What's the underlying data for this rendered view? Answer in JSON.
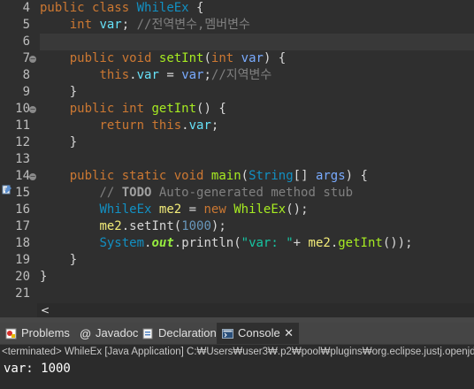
{
  "editor": {
    "line_numbers": [
      "4",
      "5",
      "6",
      "7",
      "8",
      "9",
      "10",
      "11",
      "12",
      "13",
      "14",
      "15",
      "16",
      "17",
      "18",
      "19",
      "20",
      "21"
    ],
    "lines": [
      [
        {
          "t": "public",
          "c": "kw"
        },
        {
          "t": " ",
          "c": "plain"
        },
        {
          "t": "class",
          "c": "kw"
        },
        {
          "t": " ",
          "c": "plain"
        },
        {
          "t": "WhileEx",
          "c": "cls"
        },
        {
          "t": " {",
          "c": "plain"
        }
      ],
      [
        {
          "t": "    ",
          "c": "plain"
        },
        {
          "t": "int",
          "c": "kw"
        },
        {
          "t": " ",
          "c": "plain"
        },
        {
          "t": "var",
          "c": "field"
        },
        {
          "t": "; ",
          "c": "plain"
        },
        {
          "t": "//전역변수,멤버변수",
          "c": "com"
        }
      ],
      [
        {
          "t": "",
          "c": "plain"
        }
      ],
      [
        {
          "t": "    ",
          "c": "plain"
        },
        {
          "t": "public",
          "c": "kw"
        },
        {
          "t": " ",
          "c": "plain"
        },
        {
          "t": "void",
          "c": "kw"
        },
        {
          "t": " ",
          "c": "plain"
        },
        {
          "t": "setInt",
          "c": "method"
        },
        {
          "t": "(",
          "c": "plain"
        },
        {
          "t": "int",
          "c": "kw"
        },
        {
          "t": " ",
          "c": "plain"
        },
        {
          "t": "var",
          "c": "param"
        },
        {
          "t": ") {",
          "c": "plain"
        }
      ],
      [
        {
          "t": "        ",
          "c": "plain"
        },
        {
          "t": "this",
          "c": "kw"
        },
        {
          "t": ".",
          "c": "plain"
        },
        {
          "t": "var",
          "c": "field"
        },
        {
          "t": " = ",
          "c": "plain"
        },
        {
          "t": "var",
          "c": "param"
        },
        {
          "t": ";",
          "c": "plain"
        },
        {
          "t": "//지역변수",
          "c": "com"
        }
      ],
      [
        {
          "t": "    }",
          "c": "plain"
        }
      ],
      [
        {
          "t": "    ",
          "c": "plain"
        },
        {
          "t": "public",
          "c": "kw"
        },
        {
          "t": " ",
          "c": "plain"
        },
        {
          "t": "int",
          "c": "kw"
        },
        {
          "t": " ",
          "c": "plain"
        },
        {
          "t": "getInt",
          "c": "method"
        },
        {
          "t": "() {",
          "c": "plain"
        }
      ],
      [
        {
          "t": "        ",
          "c": "plain"
        },
        {
          "t": "return",
          "c": "kw"
        },
        {
          "t": " ",
          "c": "plain"
        },
        {
          "t": "this",
          "c": "kw"
        },
        {
          "t": ".",
          "c": "plain"
        },
        {
          "t": "var",
          "c": "field"
        },
        {
          "t": ";",
          "c": "plain"
        }
      ],
      [
        {
          "t": "    }",
          "c": "plain"
        }
      ],
      [
        {
          "t": "",
          "c": "plain"
        }
      ],
      [
        {
          "t": "    ",
          "c": "plain"
        },
        {
          "t": "public",
          "c": "kw"
        },
        {
          "t": " ",
          "c": "plain"
        },
        {
          "t": "static",
          "c": "kw"
        },
        {
          "t": " ",
          "c": "plain"
        },
        {
          "t": "void",
          "c": "kw"
        },
        {
          "t": " ",
          "c": "plain"
        },
        {
          "t": "main",
          "c": "method"
        },
        {
          "t": "(",
          "c": "plain"
        },
        {
          "t": "String",
          "c": "cls"
        },
        {
          "t": "[] ",
          "c": "plain"
        },
        {
          "t": "args",
          "c": "param"
        },
        {
          "t": ") {",
          "c": "plain"
        }
      ],
      [
        {
          "t": "        ",
          "c": "plain"
        },
        {
          "t": "// ",
          "c": "com"
        },
        {
          "t": "TODO",
          "c": "todo"
        },
        {
          "t": " Auto-generated method stub",
          "c": "com"
        }
      ],
      [
        {
          "t": "        ",
          "c": "plain"
        },
        {
          "t": "WhileEx",
          "c": "cls"
        },
        {
          "t": " ",
          "c": "plain"
        },
        {
          "t": "me2",
          "c": "local"
        },
        {
          "t": " = ",
          "c": "plain"
        },
        {
          "t": "new",
          "c": "kw"
        },
        {
          "t": " ",
          "c": "plain"
        },
        {
          "t": "WhileEx",
          "c": "method"
        },
        {
          "t": "();",
          "c": "plain"
        }
      ],
      [
        {
          "t": "        ",
          "c": "plain"
        },
        {
          "t": "me2",
          "c": "local"
        },
        {
          "t": ".",
          "c": "plain"
        },
        {
          "t": "setInt",
          "c": "plain"
        },
        {
          "t": "(",
          "c": "plain"
        },
        {
          "t": "1000",
          "c": "num"
        },
        {
          "t": ");",
          "c": "plain"
        }
      ],
      [
        {
          "t": "        ",
          "c": "plain"
        },
        {
          "t": "System",
          "c": "cls"
        },
        {
          "t": ".",
          "c": "plain"
        },
        {
          "t": "out",
          "c": "static"
        },
        {
          "t": ".",
          "c": "plain"
        },
        {
          "t": "println",
          "c": "plain"
        },
        {
          "t": "(",
          "c": "plain"
        },
        {
          "t": "\"var: \"",
          "c": "str"
        },
        {
          "t": "+ ",
          "c": "plain"
        },
        {
          "t": "me2",
          "c": "local"
        },
        {
          "t": ".",
          "c": "plain"
        },
        {
          "t": "getInt",
          "c": "method"
        },
        {
          "t": "());",
          "c": "plain"
        }
      ],
      [
        {
          "t": "    }",
          "c": "plain"
        }
      ],
      [
        {
          "t": "}",
          "c": "plain"
        }
      ],
      [
        {
          "t": "",
          "c": "plain"
        }
      ]
    ],
    "fold_lines": [
      "7",
      "10",
      "14"
    ],
    "current_line": "6"
  },
  "bottom_panel": {
    "tabs": [
      {
        "label": "Problems",
        "icon": "problems-icon",
        "active": false
      },
      {
        "label": "Javadoc",
        "icon": "javadoc-icon",
        "active": false
      },
      {
        "label": "Declaration",
        "icon": "declaration-icon",
        "active": false
      },
      {
        "label": "Console",
        "icon": "console-icon",
        "active": true
      }
    ],
    "close_glyph": "✕",
    "status_text": "<terminated> WhileEx [Java Application] C:₩Users₩user3₩.p2₩pool₩plugins₩org.eclipse.justj.openjdk",
    "console_output": "var: 1000"
  },
  "scroll": {
    "left_arrow": "<"
  },
  "colors": {
    "background": "#2f2f2f",
    "keyword": "#cc7832",
    "class": "#1290c3",
    "method": "#a7ec21",
    "string": "#17c6a3"
  }
}
